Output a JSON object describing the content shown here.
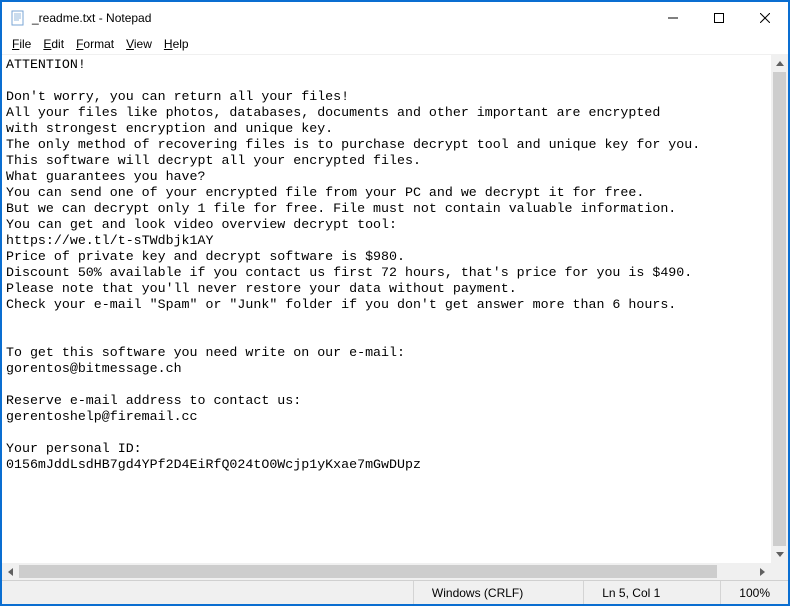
{
  "titlebar": {
    "title": "_readme.txt - Notepad"
  },
  "menubar": {
    "file": "File",
    "edit": "Edit",
    "format": "Format",
    "view": "View",
    "help": "Help"
  },
  "document": {
    "text": "ATTENTION!\n\nDon't worry, you can return all your files!\nAll your files like photos, databases, documents and other important are encrypted\nwith strongest encryption and unique key.\nThe only method of recovering files is to purchase decrypt tool and unique key for you.\nThis software will decrypt all your encrypted files.\nWhat guarantees you have?\nYou can send one of your encrypted file from your PC and we decrypt it for free.\nBut we can decrypt only 1 file for free. File must not contain valuable information.\nYou can get and look video overview decrypt tool:\nhttps://we.tl/t-sTWdbjk1AY\nPrice of private key and decrypt software is $980.\nDiscount 50% available if you contact us first 72 hours, that's price for you is $490.\nPlease note that you'll never restore your data without payment.\nCheck your e-mail \"Spam\" or \"Junk\" folder if you don't get answer more than 6 hours.\n\n\nTo get this software you need write on our e-mail:\ngorentos@bitmessage.ch\n\nReserve e-mail address to contact us:\ngerentoshelp@firemail.cc\n\nYour personal ID:\n0156mJddLsdHB7gd4YPf2D4EiRfQ024tO0Wcjp1yKxae7mGwDUpz\n"
  },
  "statusbar": {
    "encoding": "Windows (CRLF)",
    "position": "Ln 5, Col 1",
    "zoom": "100%"
  }
}
